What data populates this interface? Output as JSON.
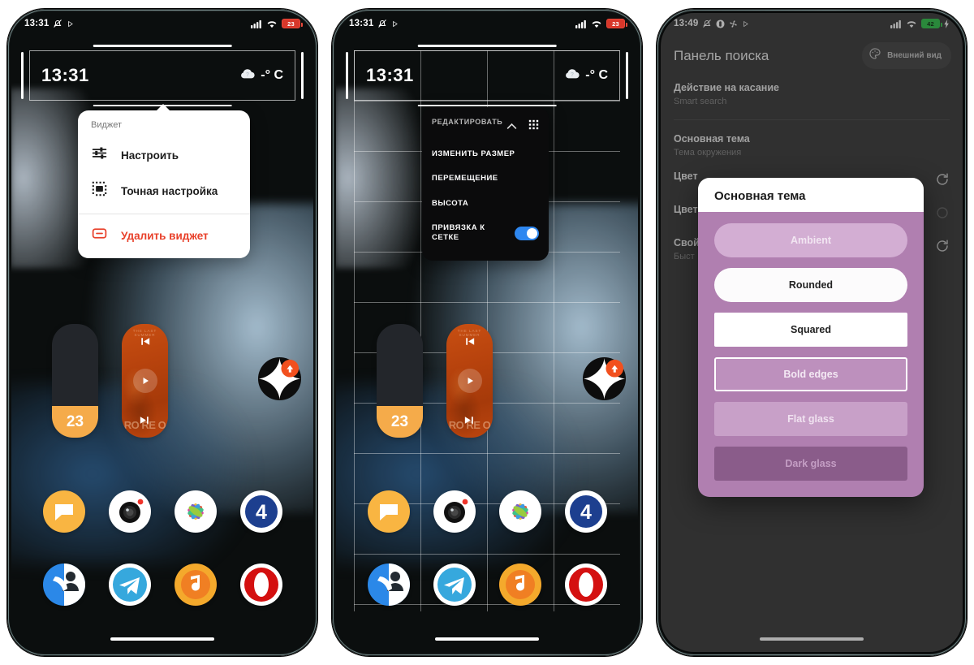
{
  "phone1": {
    "status": {
      "time": "13:31",
      "battery": "23",
      "icons": [
        "mute-icon",
        "play-icon",
        "signal-icon",
        "wifi-icon",
        "battery-icon"
      ]
    },
    "clock_widget": {
      "time": "13:31",
      "temperature": "-° C",
      "weather_icon": "cloud-question-icon"
    },
    "battery_widget": {
      "value": "23"
    },
    "music_widget": {
      "prev_icon": "skip-previous-icon",
      "play_icon": "play-icon",
      "next_icon": "skip-next-icon",
      "album_text": "RO RE O",
      "album_top": "THE LAST SUMMER"
    },
    "popup": {
      "title": "Виджет",
      "items": [
        {
          "label": "Настроить",
          "icon": "sliders-icon"
        },
        {
          "label": "Точная настройка",
          "icon": "fine-tune-grid-icon"
        }
      ],
      "danger": {
        "label": "Удалить виджет",
        "icon": "minus-box-icon"
      }
    },
    "apps_row1": [
      "messages-icon",
      "camera-icon",
      "gallery-icon",
      "four-app-icon"
    ],
    "apps_row2": [
      "contacts-icon",
      "telegram-icon",
      "music-icon",
      "opera-icon"
    ]
  },
  "phone2": {
    "status": {
      "time": "13:31",
      "battery": "23"
    },
    "clock_widget": {
      "time": "13:31",
      "temperature": "-° C"
    },
    "battery_widget": {
      "value": "23"
    },
    "popup": {
      "title": "РЕДАКТИРОВАТЬ",
      "collapse_icon": "chevron-up-icon",
      "apps_icon": "grid-dots-icon",
      "items": [
        {
          "label": "ИЗМЕНИТЬ РАЗМЕР"
        },
        {
          "label": "ПЕРЕМЕЩЕНИЕ"
        },
        {
          "label": "ВЫСОТА"
        }
      ],
      "toggle_item": {
        "label": "ПРИВЯЗКА К СЕТКЕ",
        "enabled": true
      }
    }
  },
  "phone3": {
    "status": {
      "time": "13:49",
      "battery": "42",
      "icons": [
        "mute-icon",
        "dnd-icon",
        "fan-icon",
        "play-icon",
        "signal-icon",
        "wifi-icon",
        "battery-charging-icon"
      ]
    },
    "header": {
      "title": "Панель поиска",
      "appearance_label": "Внешний вид",
      "appearance_icon": "palette-icon"
    },
    "rows": [
      {
        "title": "Действие на касание",
        "subtitle": "Smart search"
      },
      {
        "title": "Основная тема",
        "subtitle": "Тема окружения"
      },
      {
        "title": "Цвет",
        "subtitle": "",
        "action": "reset-icon"
      },
      {
        "title": "Цвет",
        "subtitle": "",
        "action": "circle-icon"
      },
      {
        "title": "Свой",
        "subtitle": "Быст",
        "action": "reset-icon"
      }
    ],
    "dialog": {
      "title": "Основная тема",
      "options": [
        "Ambient",
        "Rounded",
        "Squared",
        "Bold edges",
        "Flat glass",
        "Dark glass"
      ],
      "selected": "Bold edges"
    }
  },
  "colors": {
    "accent_orange": "#e2571a",
    "danger_red": "#e8402a",
    "toggle_blue": "#2e87f0",
    "dialog_purple": "#b07fb0",
    "settings_bg": "#474747"
  }
}
